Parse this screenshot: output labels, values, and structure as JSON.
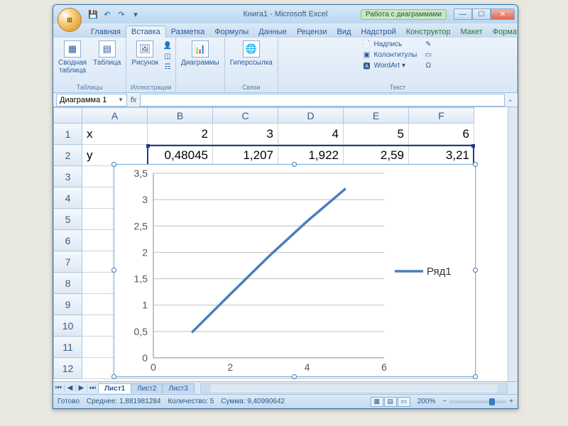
{
  "window": {
    "title": "Книга1 - Microsoft Excel",
    "chart_tools": "Работа с диаграммами"
  },
  "qat": {
    "save": "💾",
    "undo": "↶",
    "redo": "↷"
  },
  "tabs": {
    "home": "Главная",
    "insert": "Вставка",
    "layout": "Разметка",
    "formulas": "Формулы",
    "data": "Данные",
    "review": "Рецензи",
    "view": "Вид",
    "addins": "Надстрой",
    "design": "Конструктор",
    "chlayout": "Макет",
    "format": "Формат"
  },
  "ribbon": {
    "pivot": "Сводная\nтаблица",
    "table": "Таблица",
    "grp_tables": "Таблицы",
    "picture": "Рисунок",
    "grp_illus": "Иллюстрации",
    "charts": "Диаграммы",
    "hyperlink": "Гиперссылка",
    "grp_links": "Связи",
    "textbox": "Надпись",
    "headerfooter": "Колонтитулы",
    "wordart": "WordArt",
    "symbol": "Ω",
    "grp_text": "Текст"
  },
  "namebox": "Диаграмма 1",
  "cells": {
    "A1": "x",
    "B1": "2",
    "C1": "3",
    "D1": "4",
    "E1": "5",
    "F1": "6",
    "A2": "y",
    "B2": "0,48045",
    "C2": "1,207",
    "D2": "1,922",
    "E2": "2,59",
    "F2": "3,21"
  },
  "columns": [
    "A",
    "B",
    "C",
    "D",
    "E",
    "F"
  ],
  "rows": [
    "1",
    "2",
    "3",
    "4",
    "5",
    "6",
    "7",
    "8",
    "9",
    "10",
    "11",
    "12"
  ],
  "chart_data": {
    "type": "line",
    "x": [
      2,
      3,
      4,
      5,
      6
    ],
    "series": [
      {
        "name": "Ряд1",
        "values": [
          0.48045,
          1.207,
          1.922,
          2.59,
          3.21
        ]
      }
    ],
    "ylim": [
      0,
      3.5
    ],
    "ytick": [
      0,
      0.5,
      1,
      1.5,
      2,
      2.5,
      3,
      3.5
    ],
    "yticklabels": [
      "0",
      "0,5",
      "1",
      "1,5",
      "2",
      "2,5",
      "3",
      "3,5"
    ],
    "xtick": [
      0,
      2,
      4,
      6
    ],
    "legend": "Ряд1"
  },
  "sheets": {
    "s1": "Лист1",
    "s2": "Лист2",
    "s3": "Лист3"
  },
  "status": {
    "ready": "Готово",
    "avg_lbl": "Среднее:",
    "avg": "1,881981284",
    "count_lbl": "Количество:",
    "count": "5",
    "sum_lbl": "Сумма:",
    "sum": "9,40990642",
    "zoom": "200%"
  }
}
